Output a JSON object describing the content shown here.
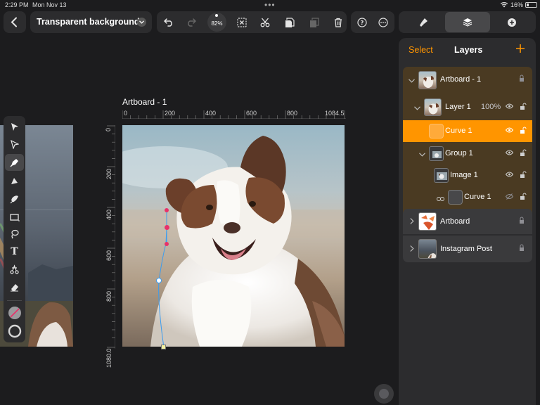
{
  "status": {
    "time": "2:29 PM",
    "date": "Mon Nov 13",
    "battery": "16%"
  },
  "header": {
    "title": "Transparent background",
    "zoom": "82%"
  },
  "artboard": {
    "label": "Artboard - 1"
  },
  "ruler": {
    "h_ticks": [
      "0",
      "200",
      "400",
      "600",
      "800",
      "1084.5"
    ],
    "v_ticks": [
      "0",
      "200",
      "400",
      "600",
      "800",
      "1080.0"
    ]
  },
  "layers": {
    "select_label": "Select",
    "title": "Layers",
    "items": [
      {
        "name": "Artboard - 1"
      },
      {
        "name": "Layer 1",
        "opacity": "100%"
      },
      {
        "name": "Curve 1"
      },
      {
        "name": "Group 1"
      },
      {
        "name": "Image 1"
      },
      {
        "name": "Curve 1"
      },
      {
        "name": "Artboard"
      },
      {
        "name": "Instagram Post"
      }
    ]
  },
  "colors": {
    "accent": "#ff9500",
    "panel": "#2c2c2e",
    "selected_row": "#ff9500",
    "artboard_group": "#4a3a22"
  }
}
